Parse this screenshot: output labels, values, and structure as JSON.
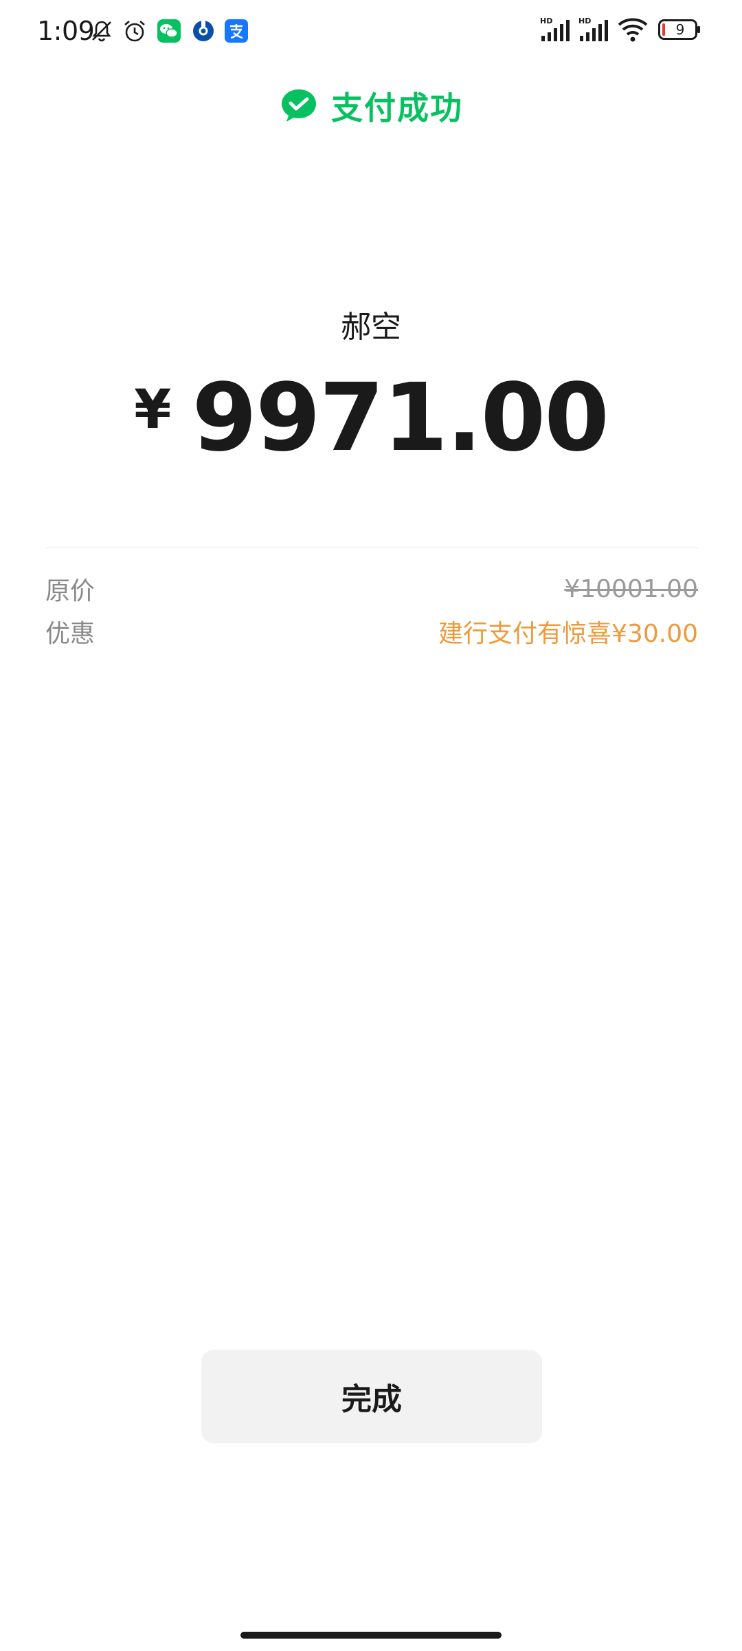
{
  "status_bar": {
    "time": "1:09",
    "battery_level": "9",
    "icons_left": [
      "bell-off-icon",
      "alarm-icon",
      "wechat-app-icon",
      "ccb-app-icon",
      "alipay-app-icon"
    ],
    "icons_right": [
      "signal-hd-1-icon",
      "signal-hd-2-icon",
      "wifi-icon",
      "battery-icon"
    ]
  },
  "header": {
    "title": "支付成功",
    "icon": "wechat-pay-check-icon",
    "accent_color": "#07c160"
  },
  "payment": {
    "payee": "郝空",
    "currency": "¥",
    "amount": "9971.00"
  },
  "details": {
    "original_label": "原价",
    "original_value": "¥10001.00",
    "discount_label": "优惠",
    "discount_value": "建行支付有惊喜¥30.00",
    "discount_color": "#f09a37"
  },
  "actions": {
    "done_label": "完成"
  }
}
